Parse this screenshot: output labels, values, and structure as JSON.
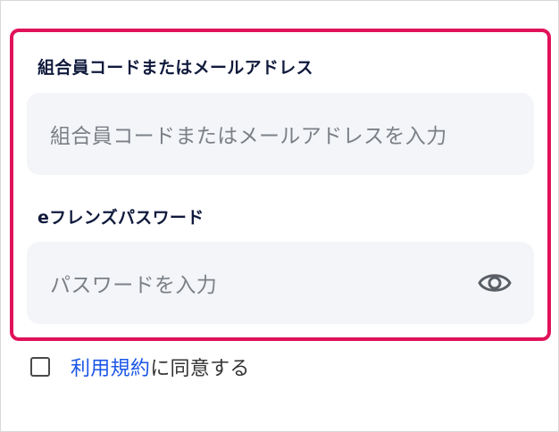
{
  "form": {
    "member_code": {
      "label": "組合員コードまたはメールアドレス",
      "placeholder": "組合員コードまたはメールアドレスを入力",
      "value": ""
    },
    "password": {
      "label": "eフレンズパスワード",
      "placeholder": "パスワードを入力",
      "value": "",
      "toggle_icon": "eye-icon"
    }
  },
  "agreement": {
    "checked": false,
    "link_text": "利用規約",
    "suffix_text": "に同意する"
  },
  "colors": {
    "highlight_border": "#e0125a",
    "label_text": "#101a3c",
    "input_background": "#f4f5f8",
    "placeholder_text": "#7b8087",
    "link": "#1a56e6"
  }
}
